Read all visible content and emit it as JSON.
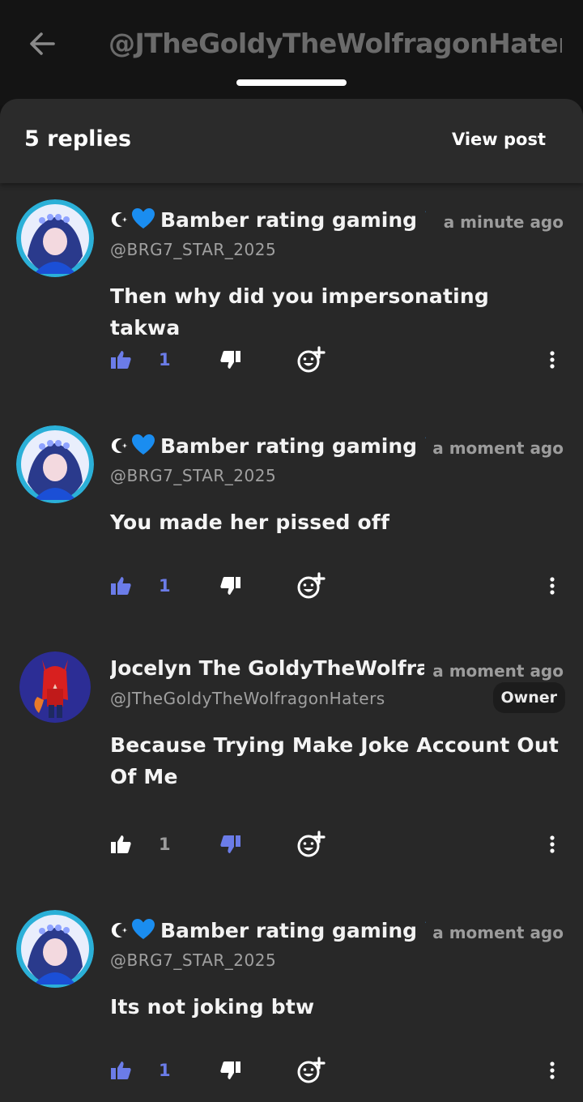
{
  "header": {
    "title": "@JTheGoldyTheWolfragonHater"
  },
  "sheet": {
    "replies_label": "5 replies",
    "view_post_label": "View post"
  },
  "colors": {
    "accent": "#6b7ce8",
    "background": "#282828",
    "muted": "#9c9c9c"
  },
  "comments": [
    {
      "display_name": "Bamber rating gaming",
      "handle": "@BRG7_STAR_2025",
      "time": "a minute ago",
      "text": "Then why did you impersonating takwa",
      "likes": "1",
      "liked": true,
      "disliked": false,
      "badge": ""
    },
    {
      "display_name": "Bamber rating gaming",
      "handle": "@BRG7_STAR_2025",
      "time": "a moment ago",
      "text": "You made her pissed off",
      "likes": "1",
      "liked": true,
      "disliked": false,
      "badge": ""
    },
    {
      "display_name": "Jocelyn The GoldyTheWolfra",
      "handle": "@JTheGoldyTheWolfragonHaters",
      "time": "a moment ago",
      "text": "Because Trying Make Joke Account Out Of Me",
      "likes": "1",
      "liked": false,
      "disliked": true,
      "badge": "Owner"
    },
    {
      "display_name": "Bamber rating gaming",
      "handle": "@BRG7_STAR_2025",
      "time": "a moment ago",
      "text": "Its not joking btw",
      "likes": "1",
      "liked": true,
      "disliked": false,
      "badge": ""
    }
  ]
}
